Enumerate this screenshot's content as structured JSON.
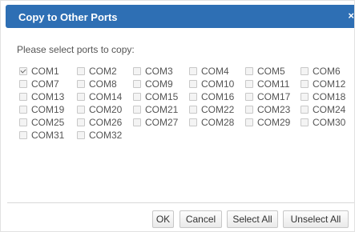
{
  "dialog": {
    "title": "Copy to Other Ports",
    "close_glyph": "×",
    "prompt": "Please select ports to copy:"
  },
  "ports": [
    {
      "label": "COM1",
      "checked": true
    },
    {
      "label": "COM2",
      "checked": false
    },
    {
      "label": "COM3",
      "checked": false
    },
    {
      "label": "COM4",
      "checked": false
    },
    {
      "label": "COM5",
      "checked": false
    },
    {
      "label": "COM6",
      "checked": false
    },
    {
      "label": "COM7",
      "checked": false
    },
    {
      "label": "COM8",
      "checked": false
    },
    {
      "label": "COM9",
      "checked": false
    },
    {
      "label": "COM10",
      "checked": false
    },
    {
      "label": "COM11",
      "checked": false
    },
    {
      "label": "COM12",
      "checked": false
    },
    {
      "label": "COM13",
      "checked": false
    },
    {
      "label": "COM14",
      "checked": false
    },
    {
      "label": "COM15",
      "checked": false
    },
    {
      "label": "COM16",
      "checked": false
    },
    {
      "label": "COM17",
      "checked": false
    },
    {
      "label": "COM18",
      "checked": false
    },
    {
      "label": "COM19",
      "checked": false
    },
    {
      "label": "COM20",
      "checked": false
    },
    {
      "label": "COM21",
      "checked": false
    },
    {
      "label": "COM22",
      "checked": false
    },
    {
      "label": "COM23",
      "checked": false
    },
    {
      "label": "COM24",
      "checked": false
    },
    {
      "label": "COM25",
      "checked": false
    },
    {
      "label": "COM26",
      "checked": false
    },
    {
      "label": "COM27",
      "checked": false
    },
    {
      "label": "COM28",
      "checked": false
    },
    {
      "label": "COM29",
      "checked": false
    },
    {
      "label": "COM30",
      "checked": false
    },
    {
      "label": "COM31",
      "checked": false
    },
    {
      "label": "COM32",
      "checked": false
    }
  ],
  "buttons": {
    "ok": "OK",
    "cancel": "Cancel",
    "select_all": "Select All",
    "unselect_all": "Unselect All"
  },
  "colors": {
    "titlebar": "#2e6fb4",
    "title_text": "#ffffff"
  }
}
